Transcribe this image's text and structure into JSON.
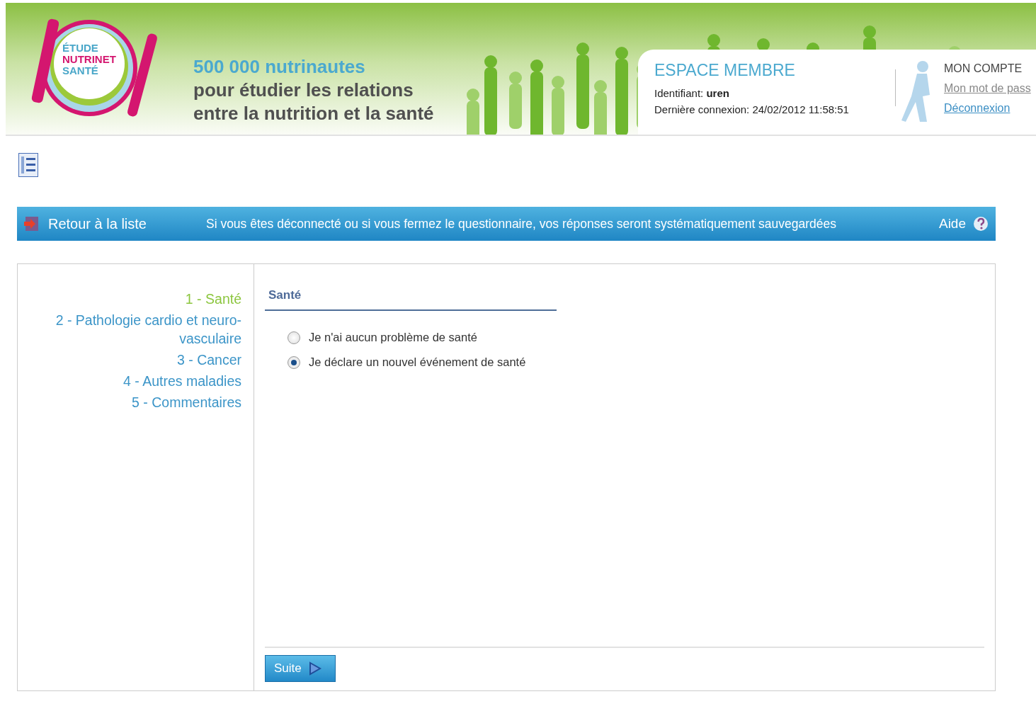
{
  "logo": {
    "lines": [
      "ÉTUDE",
      "NUTRINET",
      "SANTÉ"
    ]
  },
  "tagline": {
    "highlight": "500 000 nutrinautes",
    "lines": [
      "pour étudier les relations",
      "entre la nutrition et la santé"
    ]
  },
  "member": {
    "title": "ESPACE MEMBRE",
    "identifier": "Identifiant: **uren**",
    "last_login": "Dernière connexion: 24/02/2012 11:58:51"
  },
  "account": {
    "title": "MON COMPTE",
    "links": [
      {
        "label": "Mon mot de pass",
        "visited": true
      },
      {
        "label": "Déconnexion",
        "visited": false
      }
    ]
  },
  "toolbar": {
    "back": "Retour à la liste",
    "notice": "Si vous êtes déconnecté ou si vous fermez le questionnaire, vos réponses seront systématiquement sauvegardées",
    "help": "Aide"
  },
  "sections": [
    {
      "label": "1 - Santé",
      "selected": true
    },
    {
      "label": "2 - Pathologie cardio et neuro-vasculaire",
      "selected": false
    },
    {
      "label": "3 - Cancer",
      "selected": false
    },
    {
      "label": "4 - Autres maladies",
      "selected": false
    },
    {
      "label": "5 - Commentaires",
      "selected": false
    }
  ],
  "question": {
    "title": "Santé",
    "options": [
      {
        "label": "Je n'ai aucun problème de santé",
        "selected": false
      },
      {
        "label": "Je déclare un nouvel événement de santé",
        "selected": true
      }
    ]
  },
  "next_button": "Suite"
}
